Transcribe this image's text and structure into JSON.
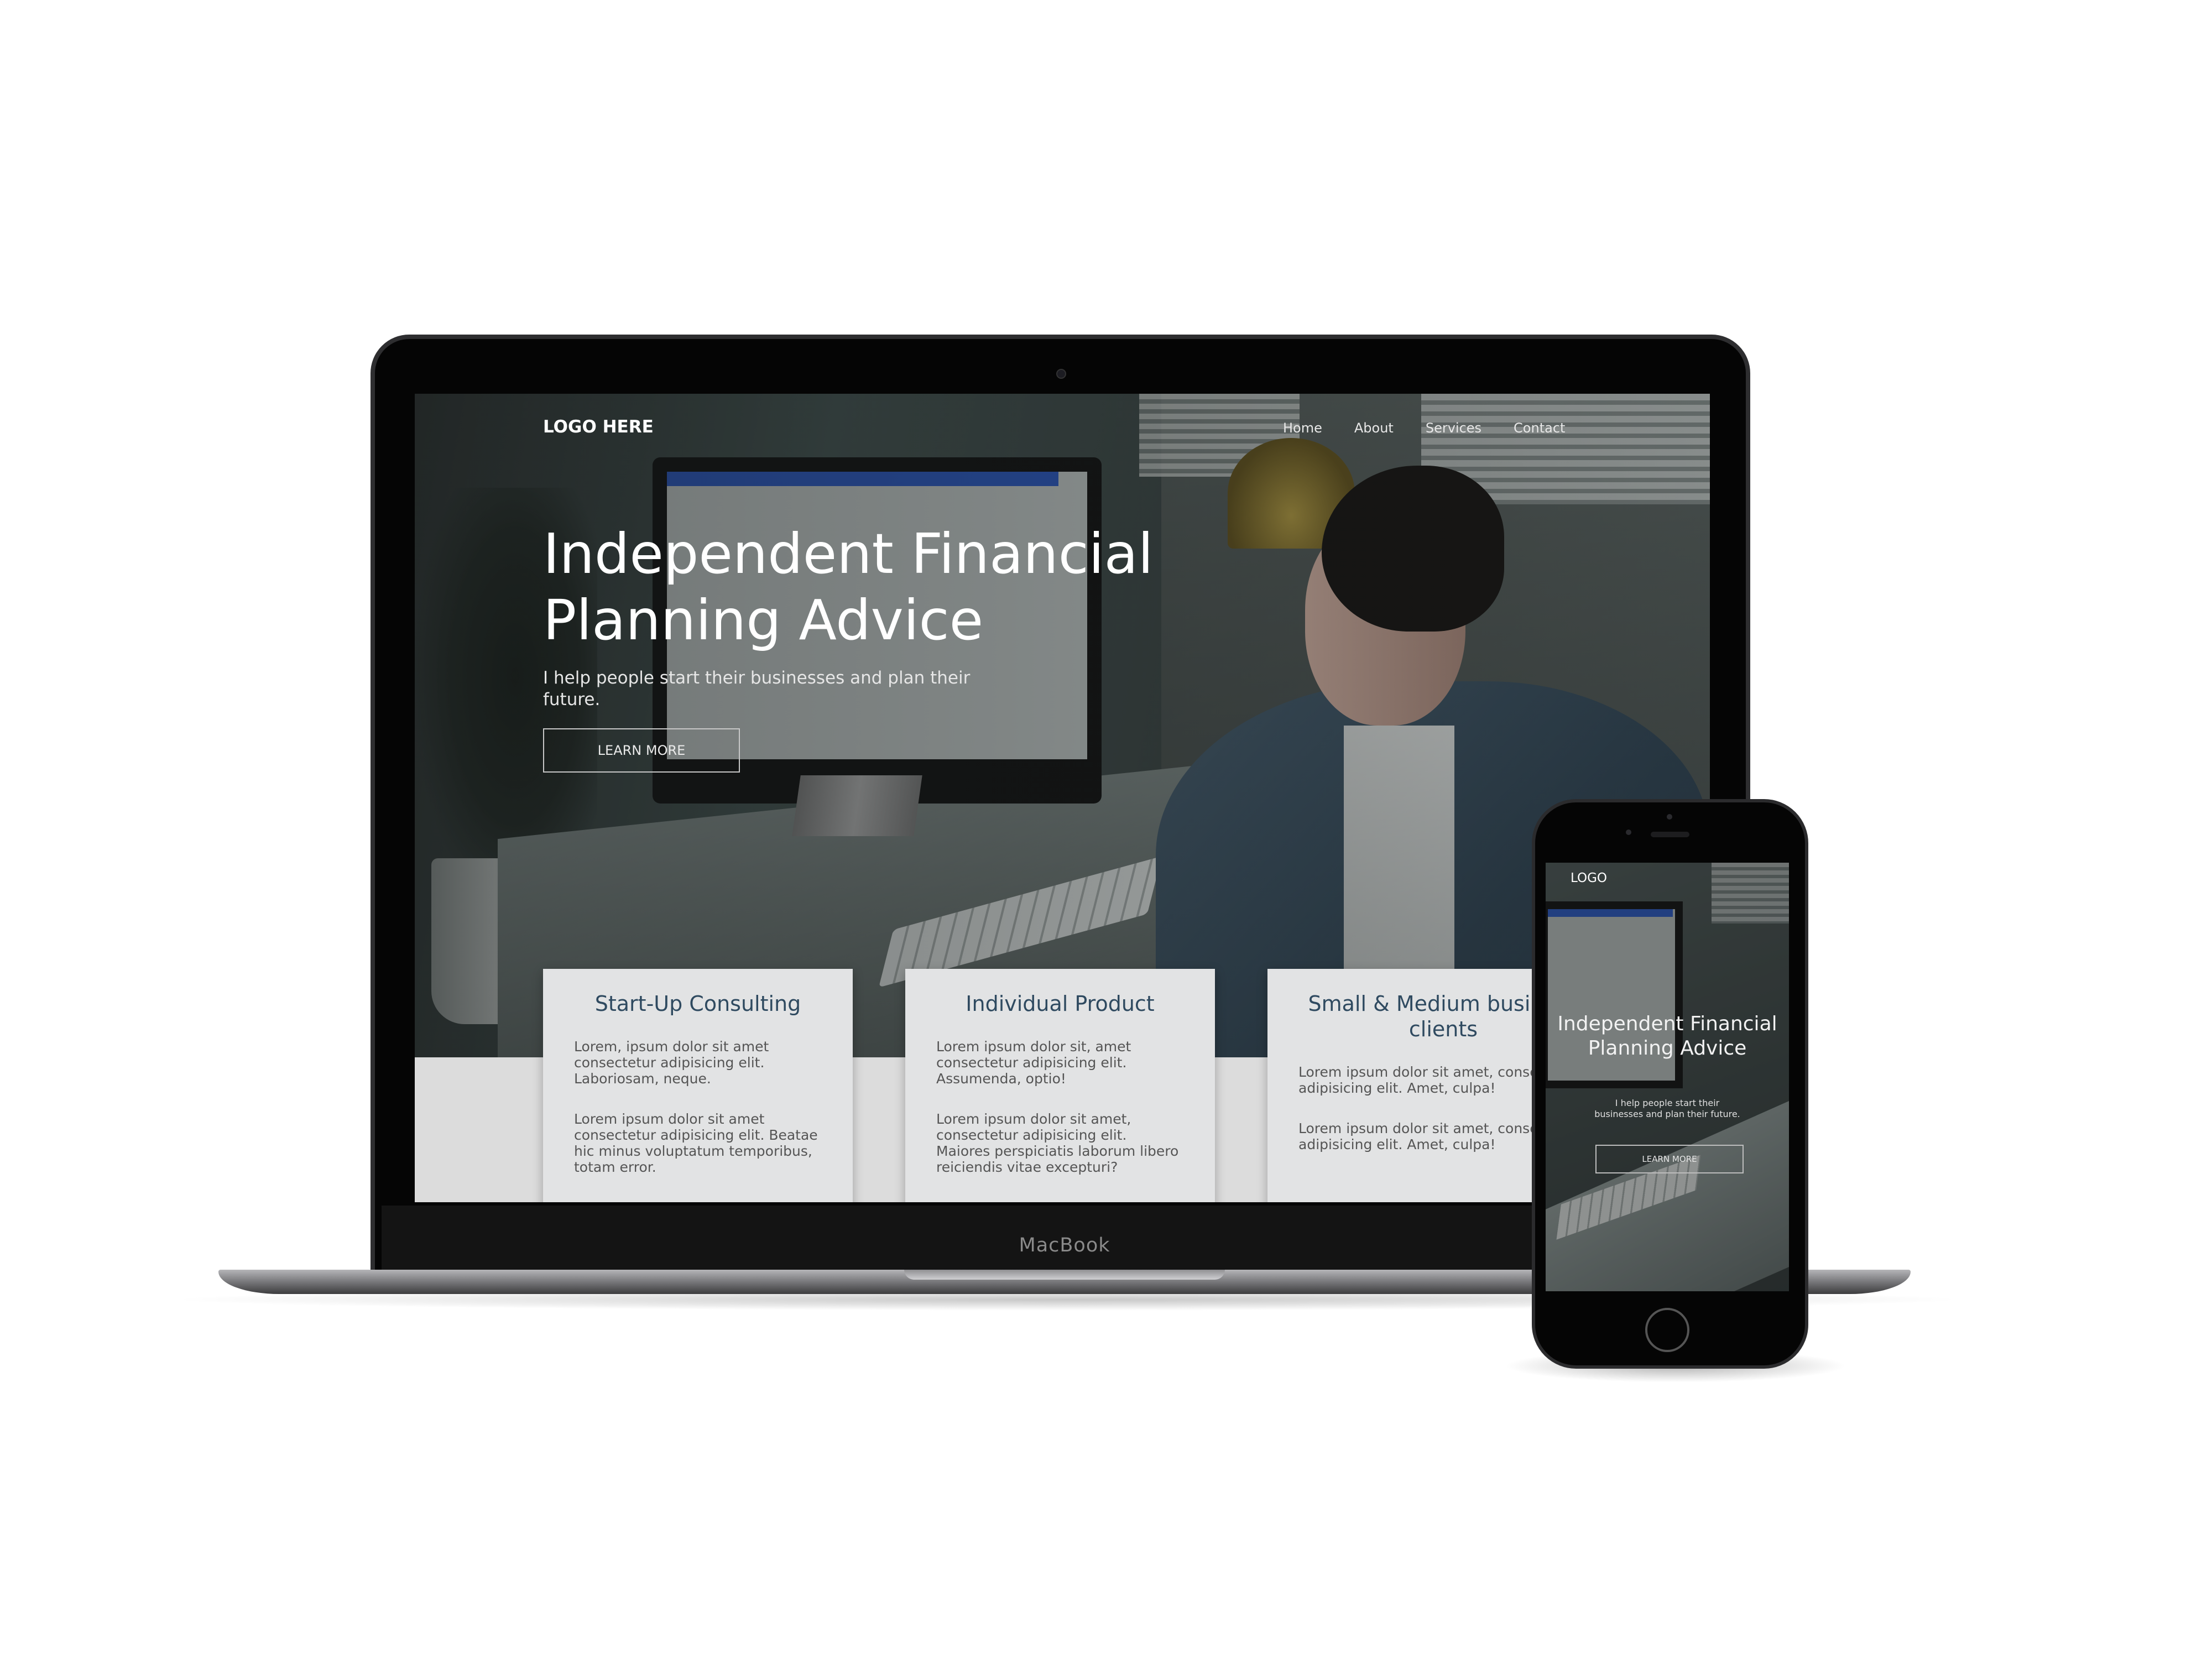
{
  "laptop": {
    "brand_label": "MacBook",
    "site": {
      "logo": "LOGO HERE",
      "nav": [
        "Home",
        "About",
        "Services",
        "Contact"
      ],
      "hero": {
        "title": "Independent Financial Planning Advice",
        "subtitle": "I help people start their businesses and plan their future.",
        "cta": "LEARN MORE"
      },
      "cards": [
        {
          "title": "Start-Up Consulting",
          "paragraphs": [
            "Lorem, ipsum dolor sit amet consectetur adipisicing elit. Laboriosam, neque.",
            "Lorem ipsum dolor sit amet consectetur adipisicing elit. Beatae hic minus voluptatum temporibus, totam error."
          ]
        },
        {
          "title": "Individual Product",
          "paragraphs": [
            "Lorem ipsum dolor sit, amet consectetur adipisicing elit. Assumenda, optio!",
            "Lorem ipsum dolor sit amet, consectetur adipisicing elit. Maiores perspiciatis laborum libero reiciendis vitae excepturi?"
          ]
        },
        {
          "title": "Small & Medium business clients",
          "paragraphs": [
            "Lorem ipsum dolor sit amet, consectetur adipisicing elit. Amet, culpa!",
            "Lorem ipsum dolor sit amet, consectetur adipisicing elit. Amet, culpa!"
          ]
        }
      ]
    }
  },
  "phone": {
    "site": {
      "logo": "LOGO",
      "hero": {
        "title": "Independent Financial Planning Advice",
        "subtitle": "I help people start their businesses and plan their future.",
        "cta": "LEARN MORE"
      }
    }
  }
}
